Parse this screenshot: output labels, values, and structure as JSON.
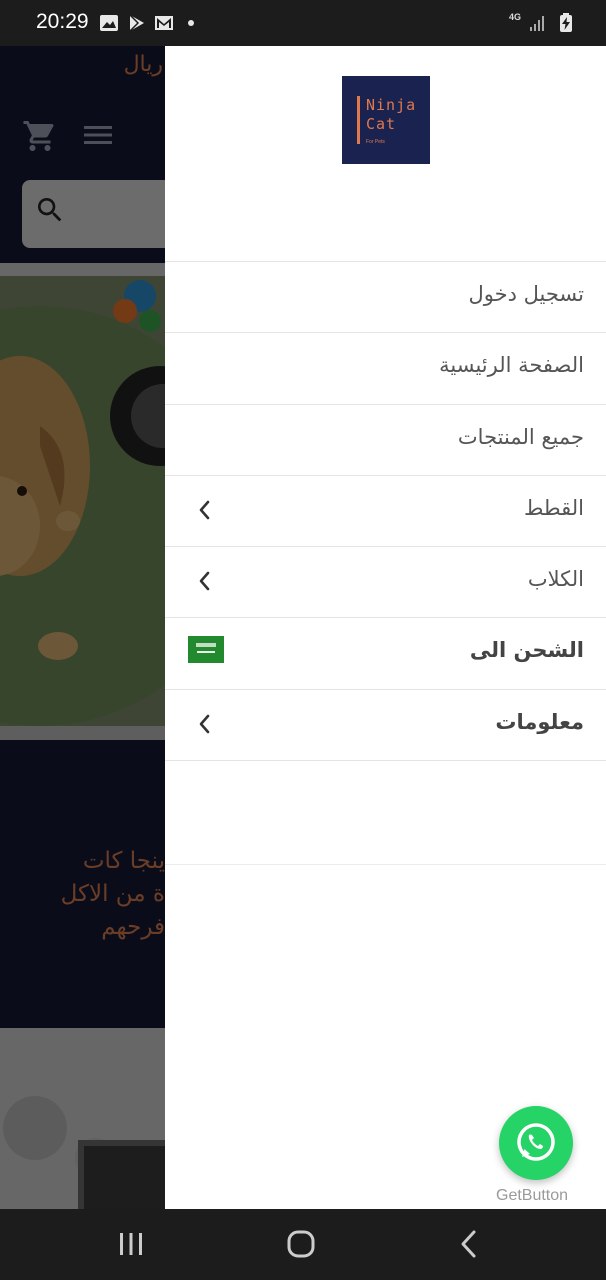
{
  "status_bar": {
    "time": "20:29",
    "network": "4G",
    "icons": [
      "gallery-icon",
      "play-store-icon",
      "gmail-icon",
      "notification-dot-icon",
      "signal-icon",
      "battery-charging-icon"
    ]
  },
  "background": {
    "currency": "ريال",
    "promo_lines": [
      "ينجا كات",
      "ة من الاكل",
      "فرحهم"
    ],
    "icons": [
      "cart-icon",
      "hamburger-menu-icon",
      "search-icon"
    ]
  },
  "drawer": {
    "logo": {
      "line1": "Ninja",
      "line2": "Cat",
      "sub": "For Pets"
    },
    "items": [
      {
        "label": "تسجيل دخول",
        "has_chevron": false,
        "bold": false
      },
      {
        "label": "الصفحة الرئيسية",
        "has_chevron": false,
        "bold": false
      },
      {
        "label": "جميع المنتجات",
        "has_chevron": false,
        "bold": false
      },
      {
        "label": "القطط",
        "has_chevron": true,
        "bold": false
      },
      {
        "label": "الكلاب",
        "has_chevron": true,
        "bold": false
      },
      {
        "label": "الشحن الى",
        "has_flag": true,
        "bold": true
      },
      {
        "label": "معلومات",
        "has_chevron": true,
        "bold": true
      }
    ]
  },
  "whatsapp": {
    "label": "GetButton",
    "color": "#25d366"
  },
  "colors": {
    "brand_navy": "#1a2350",
    "brand_orange": "#e0774d"
  }
}
